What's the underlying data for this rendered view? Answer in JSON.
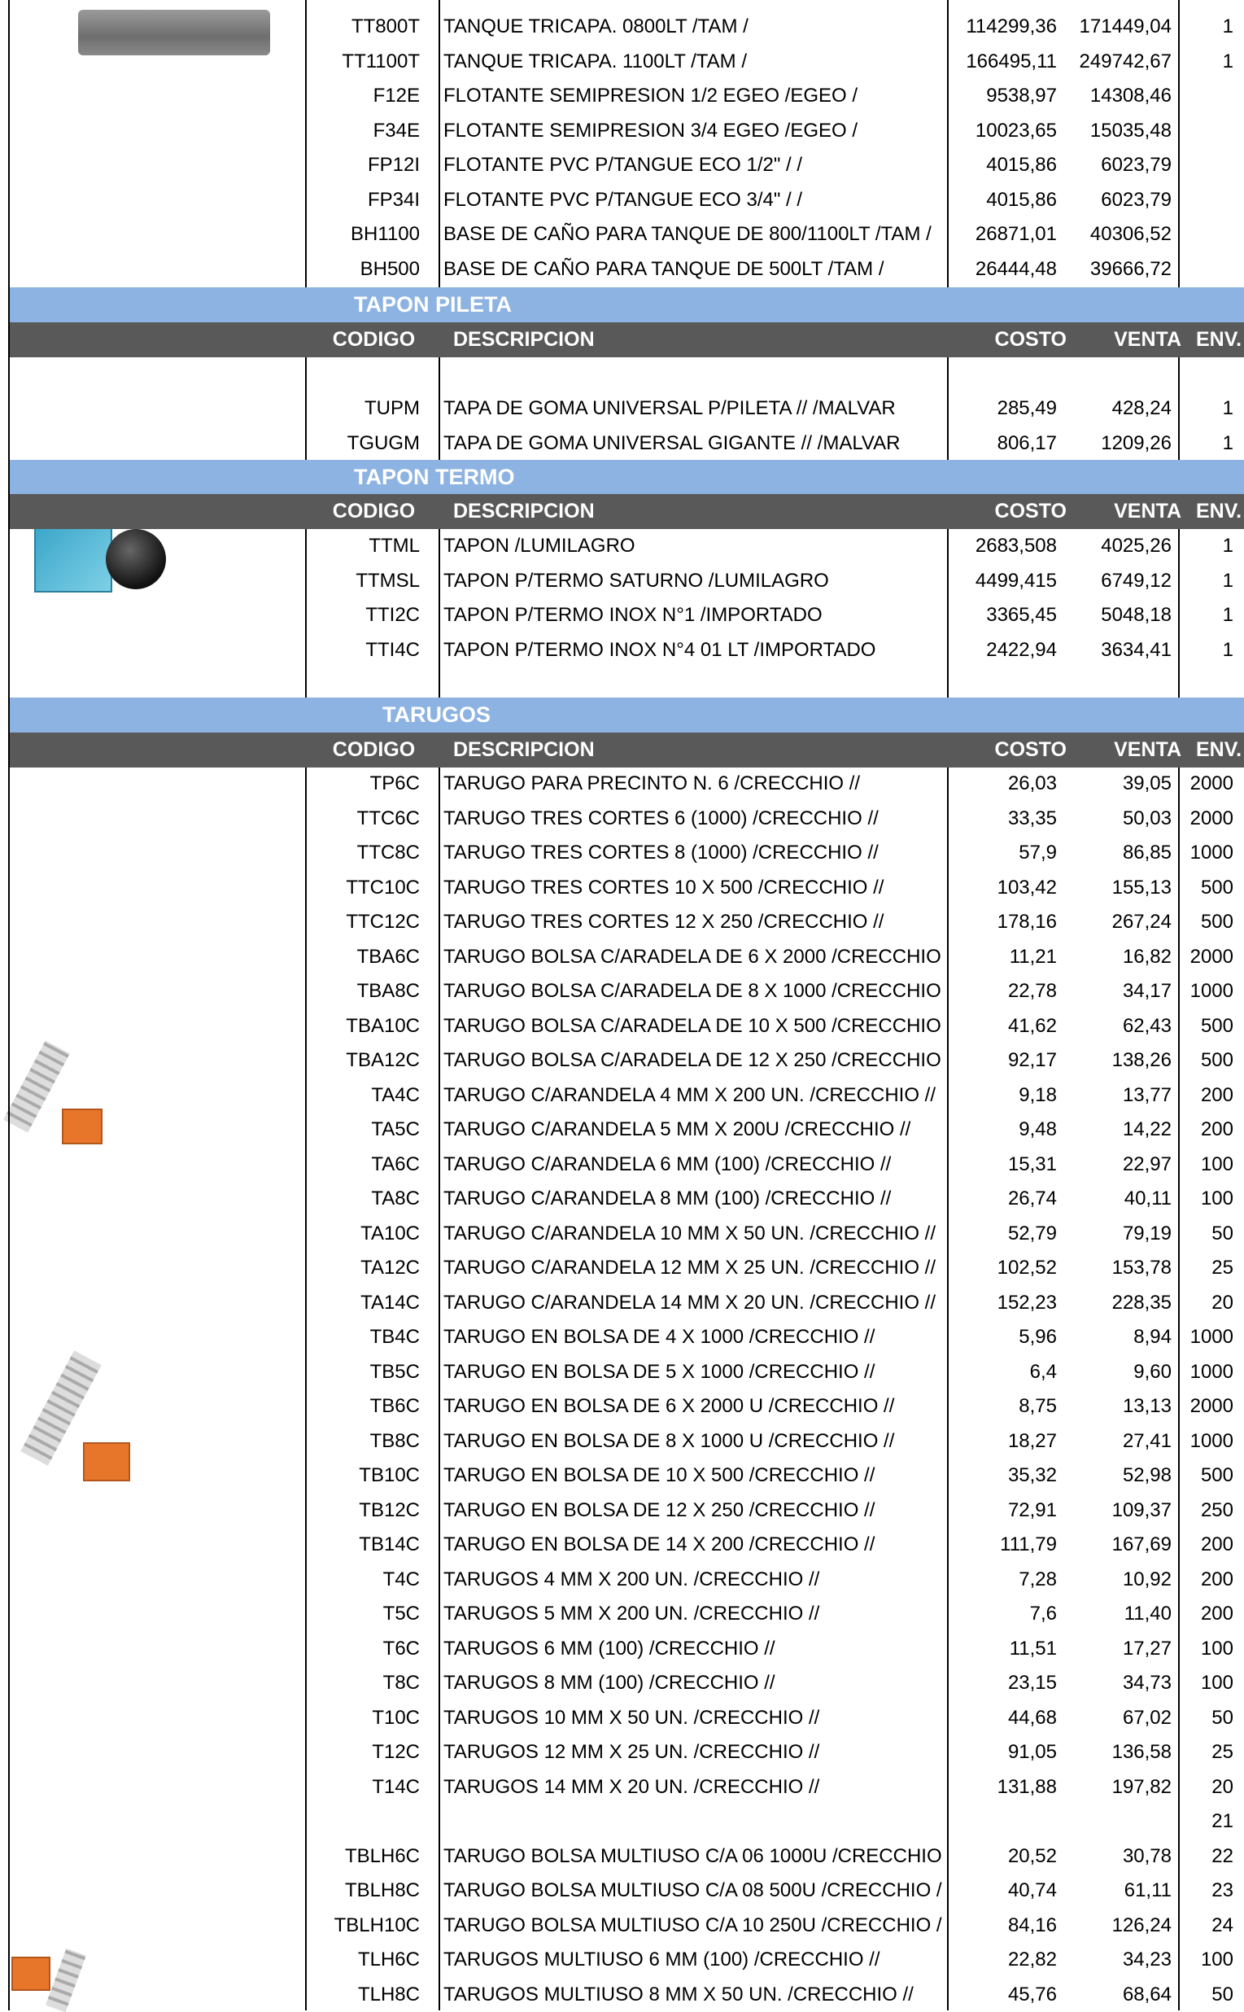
{
  "headers": {
    "code": "CODIGO",
    "desc": "DESCRIPCION",
    "cost": "COSTO",
    "sale": "VENTA",
    "env": "ENV."
  },
  "sections": [
    {
      "title": "TAPON PILETA"
    },
    {
      "title": "TAPON TERMO"
    },
    {
      "title": "TARUGOS"
    }
  ],
  "images": [
    {
      "name": "tank-product-image"
    },
    {
      "name": "thermos-stopper-product-image"
    },
    {
      "name": "wall-plug-washer-product-image"
    },
    {
      "name": "wall-plug-bag-product-image"
    },
    {
      "name": "multipurpose-plug-product-image"
    }
  ],
  "rows_top": [
    {
      "code": "TT800T",
      "desc": "TANQUE TRICAPA. 0800LT /TAM /",
      "cost": "114299,36",
      "sale": "171449,04",
      "env": "1"
    },
    {
      "code": "TT1100T",
      "desc": "TANQUE TRICAPA. 1100LT /TAM /",
      "cost": "166495,11",
      "sale": "249742,67",
      "env": "1"
    },
    {
      "code": "F12E",
      "desc": "FLOTANTE SEMIPRESION 1/2 EGEO /EGEO /",
      "cost": "9538,97",
      "sale": "14308,46",
      "env": ""
    },
    {
      "code": "F34E",
      "desc": "FLOTANTE SEMIPRESION 3/4 EGEO /EGEO /",
      "cost": "10023,65",
      "sale": "15035,48",
      "env": ""
    },
    {
      "code": "FP12I",
      "desc": "FLOTANTE PVC P/TANGUE ECO 1/2\" / /",
      "cost": "4015,86",
      "sale": "6023,79",
      "env": ""
    },
    {
      "code": "FP34I",
      "desc": "FLOTANTE PVC P/TANGUE ECO 3/4\" / /",
      "cost": "4015,86",
      "sale": "6023,79",
      "env": ""
    },
    {
      "code": "BH1100",
      "desc": "BASE DE CAÑO PARA TANQUE DE 800/1100LT /TAM /",
      "cost": "26871,01",
      "sale": "40306,52",
      "env": ""
    },
    {
      "code": "BH500",
      "desc": "BASE DE CAÑO PARA TANQUE DE 500LT /TAM /",
      "cost": "26444,48",
      "sale": "39666,72",
      "env": ""
    }
  ],
  "rows_pileta": [
    {
      "code": "TUPM",
      "desc": "TAPA DE GOMA UNIVERSAL P/PILETA // /MALVAR",
      "cost": "285,49",
      "sale": "428,24",
      "env": "1"
    },
    {
      "code": "TGUGM",
      "desc": "TAPA DE GOMA UNIVERSAL GIGANTE // /MALVAR",
      "cost": "806,17",
      "sale": "1209,26",
      "env": "1"
    }
  ],
  "rows_termo": [
    {
      "code": "TTML",
      "desc": "TAPON /LUMILAGRO",
      "cost": "2683,508",
      "sale": "4025,26",
      "env": "1"
    },
    {
      "code": "TTMSL",
      "desc": "TAPON P/TERMO SATURNO /LUMILAGRO",
      "cost": "4499,415",
      "sale": "6749,12",
      "env": "1"
    },
    {
      "code": "TTI2C",
      "desc": "TAPON P/TERMO INOX N°1 /IMPORTADO",
      "cost": "3365,45",
      "sale": "5048,18",
      "env": "1"
    },
    {
      "code": "TTI4C",
      "desc": "TAPON P/TERMO INOX N°4 01 LT /IMPORTADO",
      "cost": "2422,94",
      "sale": "3634,41",
      "env": "1"
    }
  ],
  "rows_tarugos": [
    {
      "code": "TP6C",
      "desc": "TARUGO PARA PRECINTO N. 6 /CRECCHIO //",
      "cost": "26,03",
      "sale": "39,05",
      "env": "2000"
    },
    {
      "code": "TTC6C",
      "desc": "TARUGO TRES CORTES 6 (1000) /CRECCHIO //",
      "cost": "33,35",
      "sale": "50,03",
      "env": "2000"
    },
    {
      "code": "TTC8C",
      "desc": "TARUGO TRES CORTES 8 (1000) /CRECCHIO //",
      "cost": "57,9",
      "sale": "86,85",
      "env": "1000"
    },
    {
      "code": "TTC10C",
      "desc": "TARUGO TRES CORTES 10 X 500 /CRECCHIO //",
      "cost": "103,42",
      "sale": "155,13",
      "env": "500"
    },
    {
      "code": "TTC12C",
      "desc": "TARUGO TRES CORTES 12 X 250 /CRECCHIO //",
      "cost": "178,16",
      "sale": "267,24",
      "env": "500"
    },
    {
      "code": "TBA6C",
      "desc": "TARUGO BOLSA C/ARADELA DE 6 X 2000 /CRECCHIO",
      "cost": "11,21",
      "sale": "16,82",
      "env": "2000"
    },
    {
      "code": "TBA8C",
      "desc": "TARUGO BOLSA C/ARADELA DE 8 X 1000 /CRECCHIO",
      "cost": "22,78",
      "sale": "34,17",
      "env": "1000"
    },
    {
      "code": "TBA10C",
      "desc": "TARUGO BOLSA C/ARADELA DE 10 X 500 /CRECCHIO",
      "cost": "41,62",
      "sale": "62,43",
      "env": "500"
    },
    {
      "code": "TBA12C",
      "desc": "TARUGO BOLSA C/ARADELA DE 12 X 250 /CRECCHIO",
      "cost": "92,17",
      "sale": "138,26",
      "env": "500"
    },
    {
      "code": "TA4C",
      "desc": "TARUGO C/ARANDELA 4 MM X 200 UN. /CRECCHIO //",
      "cost": "9,18",
      "sale": "13,77",
      "env": "200"
    },
    {
      "code": "TA5C",
      "desc": "TARUGO C/ARANDELA 5 MM X 200U /CRECCHIO //",
      "cost": "9,48",
      "sale": "14,22",
      "env": "200"
    },
    {
      "code": "TA6C",
      "desc": "TARUGO C/ARANDELA 6 MM (100) /CRECCHIO //",
      "cost": "15,31",
      "sale": "22,97",
      "env": "100"
    },
    {
      "code": "TA8C",
      "desc": "TARUGO C/ARANDELA 8 MM (100) /CRECCHIO //",
      "cost": "26,74",
      "sale": "40,11",
      "env": "100"
    },
    {
      "code": "TA10C",
      "desc": "TARUGO C/ARANDELA 10 MM X 50 UN. /CRECCHIO //",
      "cost": "52,79",
      "sale": "79,19",
      "env": "50"
    },
    {
      "code": "TA12C",
      "desc": "TARUGO C/ARANDELA 12 MM X 25 UN. /CRECCHIO //",
      "cost": "102,52",
      "sale": "153,78",
      "env": "25"
    },
    {
      "code": "TA14C",
      "desc": "TARUGO C/ARANDELA 14 MM X 20 UN. /CRECCHIO //",
      "cost": "152,23",
      "sale": "228,35",
      "env": "20"
    },
    {
      "code": "TB4C",
      "desc": "TARUGO EN BOLSA DE 4 X 1000 /CRECCHIO //",
      "cost": "5,96",
      "sale": "8,94",
      "env": "1000"
    },
    {
      "code": "TB5C",
      "desc": "TARUGO EN BOLSA DE 5 X 1000 /CRECCHIO //",
      "cost": "6,4",
      "sale": "9,60",
      "env": "1000"
    },
    {
      "code": "TB6C",
      "desc": "TARUGO EN BOLSA DE 6 X 2000 U /CRECCHIO //",
      "cost": "8,75",
      "sale": "13,13",
      "env": "2000"
    },
    {
      "code": "TB8C",
      "desc": "TARUGO EN BOLSA DE 8 X 1000 U /CRECCHIO //",
      "cost": "18,27",
      "sale": "27,41",
      "env": "1000"
    },
    {
      "code": "TB10C",
      "desc": "TARUGO EN BOLSA DE 10 X 500 /CRECCHIO //",
      "cost": "35,32",
      "sale": "52,98",
      "env": "500"
    },
    {
      "code": "TB12C",
      "desc": "TARUGO EN BOLSA DE 12 X 250 /CRECCHIO //",
      "cost": "72,91",
      "sale": "109,37",
      "env": "250"
    },
    {
      "code": "TB14C",
      "desc": "TARUGO EN BOLSA DE 14 X 200 /CRECCHIO //",
      "cost": "111,79",
      "sale": "167,69",
      "env": "200"
    },
    {
      "code": "T4C",
      "desc": "TARUGOS 4 MM X 200 UN. /CRECCHIO //",
      "cost": "7,28",
      "sale": "10,92",
      "env": "200"
    },
    {
      "code": "T5C",
      "desc": "TARUGOS 5 MM X 200 UN. /CRECCHIO //",
      "cost": "7,6",
      "sale": "11,40",
      "env": "200"
    },
    {
      "code": "T6C",
      "desc": "TARUGOS 6 MM (100) /CRECCHIO //",
      "cost": "11,51",
      "sale": "17,27",
      "env": "100"
    },
    {
      "code": "T8C",
      "desc": "TARUGOS 8 MM (100) /CRECCHIO //",
      "cost": "23,15",
      "sale": "34,73",
      "env": "100"
    },
    {
      "code": "T10C",
      "desc": "TARUGOS 10 MM X 50 UN. /CRECCHIO //",
      "cost": "44,68",
      "sale": "67,02",
      "env": "50"
    },
    {
      "code": "T12C",
      "desc": "TARUGOS 12 MM X 25 UN. /CRECCHIO //",
      "cost": "91,05",
      "sale": "136,58",
      "env": "25"
    },
    {
      "code": "T14C",
      "desc": "TARUGOS 14 MM X 20 UN. /CRECCHIO //",
      "cost": "131,88",
      "sale": "197,82",
      "env": "20"
    },
    {
      "code": "",
      "desc": "",
      "cost": "",
      "sale": "",
      "env": "21"
    },
    {
      "code": "TBLH6C",
      "desc": "TARUGO BOLSA MULTIUSO C/A 06 1000U /CRECCHIO",
      "cost": "20,52",
      "sale": "30,78",
      "env": "22"
    },
    {
      "code": "TBLH8C",
      "desc": "TARUGO BOLSA MULTIUSO C/A 08 500U /CRECCHIO /",
      "cost": "40,74",
      "sale": "61,11",
      "env": "23"
    },
    {
      "code": "TBLH10C",
      "desc": "TARUGO BOLSA MULTIUSO C/A 10 250U /CRECCHIO /",
      "cost": "84,16",
      "sale": "126,24",
      "env": "24"
    },
    {
      "code": "TLH6C",
      "desc": "TARUGOS MULTIUSO 6 MM (100) /CRECCHIO //",
      "cost": "22,82",
      "sale": "34,23",
      "env": "100"
    },
    {
      "code": "TLH8C",
      "desc": "TARUGOS MULTIUSO 8 MM X 50 UN. /CRECCHIO //",
      "cost": "45,76",
      "sale": "68,64",
      "env": "50"
    }
  ]
}
